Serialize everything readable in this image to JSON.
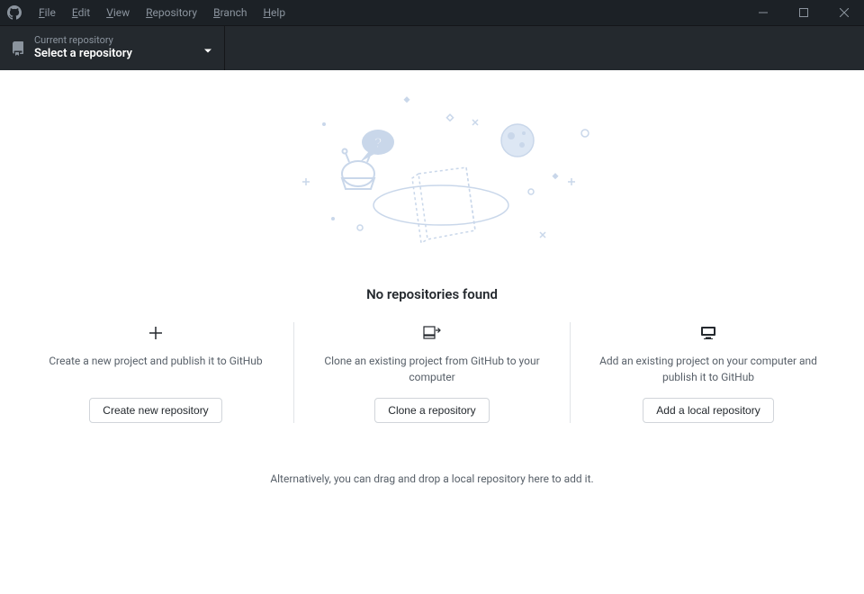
{
  "menubar": {
    "items": [
      {
        "hotkey": "F",
        "rest": "ile"
      },
      {
        "hotkey": "E",
        "rest": "dit"
      },
      {
        "hotkey": "V",
        "rest": "iew"
      },
      {
        "hotkey": "R",
        "rest": "epository"
      },
      {
        "hotkey": "B",
        "rest": "ranch"
      },
      {
        "hotkey": "H",
        "rest": "elp"
      }
    ]
  },
  "toolbar": {
    "repo_label_top": "Current repository",
    "repo_label_bottom": "Select a repository"
  },
  "main": {
    "heading": "No repositories found",
    "columns": [
      {
        "icon": "plus-icon",
        "desc": "Create a new project and publish it to GitHub",
        "button": "Create new repository"
      },
      {
        "icon": "clone-icon",
        "desc": "Clone an existing project from GitHub to your computer",
        "button": "Clone a repository"
      },
      {
        "icon": "computer-icon",
        "desc": "Add an existing project on your computer and publish it to GitHub",
        "button": "Add a local repository"
      }
    ],
    "alt_text": "Alternatively, you can drag and drop a local repository here to add it."
  }
}
